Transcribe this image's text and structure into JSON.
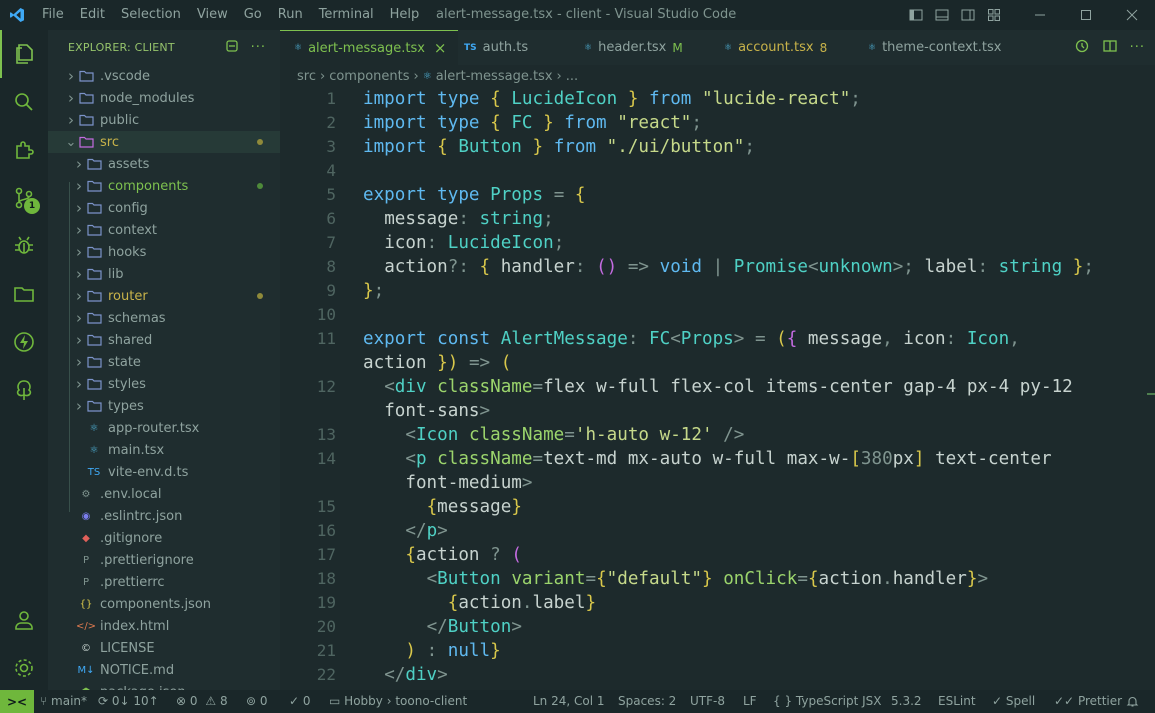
{
  "titlebar": {
    "menu": [
      "File",
      "Edit",
      "Selection",
      "View",
      "Go",
      "Run",
      "Terminal",
      "Help"
    ],
    "title": "alert-message.tsx - client - Visual Studio Code"
  },
  "activity": {
    "scm_badge": "1"
  },
  "sidebar": {
    "header": "EXPLORER: CLIENT",
    "items": [
      {
        "label": ".vscode"
      },
      {
        "label": "node_modules"
      },
      {
        "label": "public"
      },
      {
        "label": "src"
      },
      {
        "label": "assets"
      },
      {
        "label": "components"
      },
      {
        "label": "config"
      },
      {
        "label": "context"
      },
      {
        "label": "hooks"
      },
      {
        "label": "lib"
      },
      {
        "label": "router"
      },
      {
        "label": "schemas"
      },
      {
        "label": "shared"
      },
      {
        "label": "state"
      },
      {
        "label": "styles"
      },
      {
        "label": "types"
      },
      {
        "label": "app-router.tsx"
      },
      {
        "label": "main.tsx"
      },
      {
        "label": "vite-env.d.ts"
      },
      {
        "label": ".env.local"
      },
      {
        "label": ".eslintrc.json"
      },
      {
        "label": ".gitignore"
      },
      {
        "label": ".prettierignore"
      },
      {
        "label": ".prettierrc"
      },
      {
        "label": "components.json"
      },
      {
        "label": "index.html"
      },
      {
        "label": "LICENSE"
      },
      {
        "label": "NOTICE.md"
      },
      {
        "label": "package.json"
      }
    ]
  },
  "tabs": [
    {
      "label": "alert-message.tsx",
      "icon": "react-icon",
      "close": "×"
    },
    {
      "label": "auth.ts",
      "icon": "TS"
    },
    {
      "label": "header.tsx",
      "icon": "react-icon",
      "mark": "M"
    },
    {
      "label": "account.tsx",
      "icon": "react-icon",
      "mark": "8"
    },
    {
      "label": "theme-context.tsx",
      "icon": "react-icon"
    }
  ],
  "breadcrumb": {
    "parts": [
      "src",
      "components",
      "alert-message.tsx",
      "..."
    ]
  },
  "editor": {
    "line_numbers": [
      "1",
      "2",
      "3",
      "4",
      "5",
      "6",
      "7",
      "8",
      "9",
      "10",
      "11",
      "12",
      "13",
      "14",
      "15",
      "16",
      "17",
      "18",
      "19",
      "20",
      "21",
      "22"
    ],
    "lines": [
      "import type { LucideIcon } from \"lucide-react\";",
      "import type { FC } from \"react\";",
      "import { Button } from \"./ui/button\";",
      "",
      "export type Props = {",
      "  message: string;",
      "  icon: LucideIcon;",
      "  action?: { handler: () => void | Promise<unknown>; label: string };",
      "};",
      "",
      "export const AlertMessage: FC<Props> = ({ message, icon: Icon,",
      "action }) => (",
      "  <div className='flex w-full flex-col items-center gap-4 px-4 py-12",
      "  font-sans'>",
      "    <Icon className='h-auto w-12' />",
      "    <p className='text-md mx-auto w-full max-w-[380px] text-center",
      "    font-medium'>",
      "      {message}",
      "    </p>",
      "    {action ? (",
      "      <Button variant={\"default\"} onClick={action.handler}>",
      "        {action.label}",
      "      </Button>",
      "    ) : null}",
      "  </div>"
    ]
  },
  "statusbar": {
    "remote": "><",
    "branch": "main*",
    "sync": "0↓ 10↑",
    "problems_errors": "0",
    "problems_warnings": "8",
    "ports": "0",
    "info": "0",
    "folder": "Hobby",
    "workspace": "toono-client",
    "position": "Ln 24, Col 1",
    "spaces": "Spaces: 2",
    "encoding": "UTF-8",
    "eol": "LF",
    "language": "TypeScript JSX",
    "version": "5.3.2",
    "linter": "ESLint",
    "spell": "Spell",
    "formatter": "Prettier"
  },
  "colors": {
    "accent": "#7ec14f",
    "modified": "#c8b34a",
    "background": "#1d2a2c",
    "sidebar": "#1f2d2f"
  }
}
